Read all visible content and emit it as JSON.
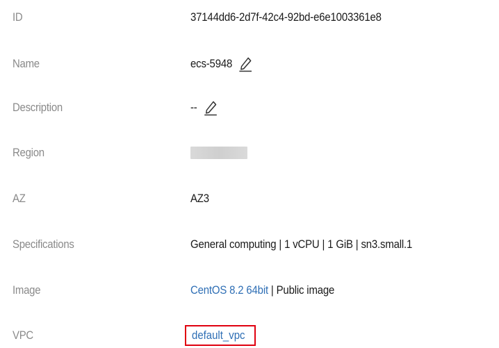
{
  "rows": {
    "id": {
      "label": "ID",
      "value": "37144dd6-2d7f-42c4-92bd-e6e1003361e8"
    },
    "name": {
      "label": "Name",
      "value": "ecs-5948",
      "icon": "edit-pencil-icon"
    },
    "description": {
      "label": "Description",
      "value": "--",
      "icon": "edit-pencil-icon"
    },
    "region": {
      "label": "Region",
      "value": ""
    },
    "az": {
      "label": "AZ",
      "value": "AZ3"
    },
    "specifications": {
      "label": "Specifications",
      "value": "General computing | 1 vCPU | 1 GiB | sn3.small.1"
    },
    "image": {
      "label": "Image",
      "link": "CentOS 8.2 64bit",
      "suffix": " | Public image"
    },
    "vpc": {
      "label": "VPC",
      "link": "default_vpc"
    }
  },
  "colors": {
    "label": "#8a8a8a",
    "value": "#1a1a1a",
    "link": "#2f6fb5",
    "highlight_border": "#e0000f"
  }
}
